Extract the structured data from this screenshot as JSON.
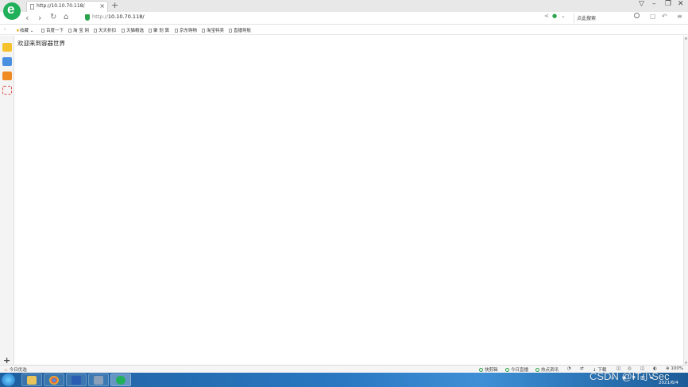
{
  "browser": {
    "tab_title": "http://10.10.70.118/",
    "tab_close": "×",
    "new_tab": "+",
    "url_scheme": "http://",
    "url_host": "10.10.70.118/",
    "search_placeholder": "点此搜索",
    "accent_color": "#20b05a"
  },
  "bookmarks": {
    "favorites_label": "收藏",
    "items": [
      "百度一下",
      "淘 宝 网",
      "天天折扣",
      "天猫精选",
      "聚 划 算",
      "京东购物",
      "淘宝特卖",
      "直播导航"
    ]
  },
  "page": {
    "content_text": "欢迎来到容器世界"
  },
  "statusbar": {
    "left_label": "今日优选",
    "items": [
      "快剪辑",
      "今日直播",
      "热点资讯"
    ],
    "download_label": "下载",
    "zoom": "100%"
  },
  "taskbar": {
    "date": "2021/6/4"
  },
  "watermark": "CSDN @IT小Sec"
}
